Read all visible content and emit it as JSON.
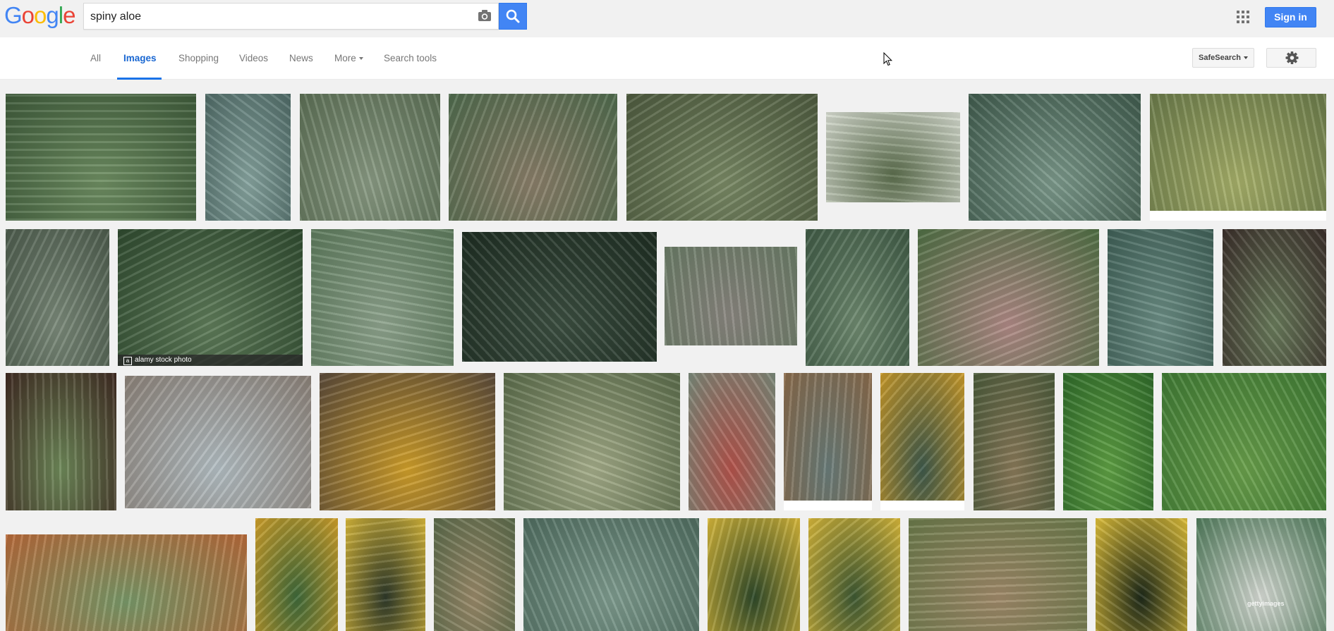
{
  "logo": {
    "letters": [
      {
        "ch": "G",
        "color": "#4285f4"
      },
      {
        "ch": "o",
        "color": "#ea4335"
      },
      {
        "ch": "o",
        "color": "#fbbc05"
      },
      {
        "ch": "g",
        "color": "#4285f4"
      },
      {
        "ch": "l",
        "color": "#34a853"
      },
      {
        "ch": "e",
        "color": "#ea4335"
      }
    ]
  },
  "search": {
    "query": "spiny aloe"
  },
  "header": {
    "signin_label": "Sign in"
  },
  "nav": {
    "tabs": [
      {
        "label": "All"
      },
      {
        "label": "Images",
        "active": true
      },
      {
        "label": "Shopping"
      },
      {
        "label": "Videos"
      },
      {
        "label": "News"
      },
      {
        "label": "More"
      },
      {
        "label": "Search tools"
      }
    ],
    "safesearch_label": "SafeSearch"
  },
  "results": {
    "thumbs": [
      {
        "c1": "#6f8f63",
        "c2": "#3e5a3a"
      },
      {
        "c1": "#88a5a0",
        "c2": "#4f6a66"
      },
      {
        "c1": "#8a9b84",
        "c2": "#5c6f55"
      },
      {
        "c1": "#8b7f6a",
        "c2": "#4f6b4d"
      },
      {
        "c1": "#7a8a66",
        "c2": "#4d5a3e"
      },
      {
        "c1": "#5d6f4e",
        "c2": "#d8ddd2"
      },
      {
        "c1": "#7d9a8c",
        "c2": "#3f5a4c"
      },
      {
        "c1": "#a7b06a",
        "c2": "#6a7a4a"
      },
      {
        "c1": "#7b8a7a",
        "c2": "#4c5b4c"
      },
      {
        "c1": "#5f7c5a",
        "c2": "#2f4a2f"
      },
      {
        "c1": "#8fa48e",
        "c2": "#5d7a5c"
      },
      {
        "c1": "#3c4f41",
        "c2": "#1e2d22"
      },
      {
        "c1": "#8a8680",
        "c2": "#6a7c66"
      },
      {
        "c1": "#6f8a70",
        "c2": "#3f5a45"
      },
      {
        "c1": "#b08a86",
        "c2": "#4f6f44"
      },
      {
        "c1": "#6d8f86",
        "c2": "#3f5f56"
      },
      {
        "c1": "#6a7c5c",
        "c2": "#3a2e2a"
      },
      {
        "c1": "#6f8a5a",
        "c2": "#3f2a22"
      },
      {
        "c1": "#b4bfc4",
        "c2": "#8b8178"
      },
      {
        "c1": "#d1a02a",
        "c2": "#5a4a3a"
      },
      {
        "c1": "#a5ad8a",
        "c2": "#5a6b4a"
      },
      {
        "c1": "#b5544c",
        "c2": "#7a8a7a"
      },
      {
        "c1": "#6a7d7a",
        "c2": "#8a6a4a"
      },
      {
        "c1": "#3f5a4c",
        "c2": "#c99a2a"
      },
      {
        "c1": "#8a7a5a",
        "c2": "#4a5a3a"
      },
      {
        "c1": "#5fa044",
        "c2": "#2f6a2a"
      },
      {
        "c1": "#6aa04c",
        "c2": "#3f7a34"
      },
      {
        "c1": "#7a9a6a",
        "c2": "#b86a3a"
      },
      {
        "c1": "#3f6a3a",
        "c2": "#d0a02a"
      },
      {
        "c1": "#2f3a2a",
        "c2": "#d8b83a"
      },
      {
        "c1": "#9a8a6a",
        "c2": "#5a6a4a"
      },
      {
        "c1": "#7f9c8f",
        "c2": "#4f6c5f"
      },
      {
        "c1": "#2f4a2a",
        "c2": "#d8b83a"
      },
      {
        "c1": "#3f5a34",
        "c2": "#d8b83a"
      },
      {
        "c1": "#a08a6a",
        "c2": "#6a7a4a"
      },
      {
        "c1": "#1e2a1a",
        "c2": "#e0c03a"
      },
      {
        "c1": "#d8dcd6",
        "c2": "#4f7a5a"
      }
    ],
    "captions": {
      "alamy": "alamy stock photo",
      "getty": "gettyimages"
    }
  }
}
